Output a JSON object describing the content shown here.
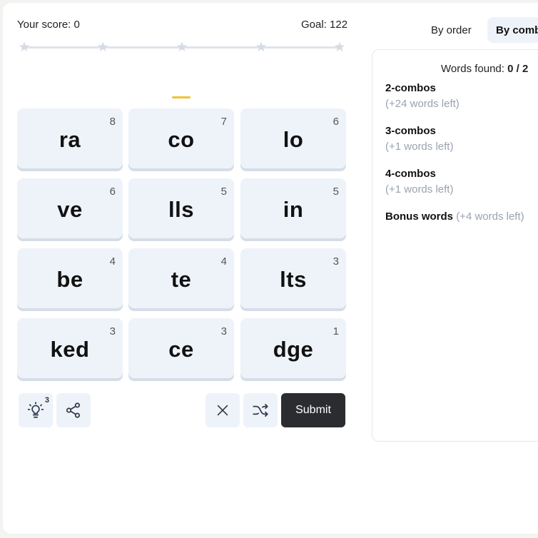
{
  "header": {
    "score_label": "Your score: 0",
    "goal_label": "Goal: 122",
    "progress_fraction": 0
  },
  "tiles": [
    {
      "text": "ra",
      "count": "8"
    },
    {
      "text": "co",
      "count": "7"
    },
    {
      "text": "lo",
      "count": "6"
    },
    {
      "text": "ve",
      "count": "6"
    },
    {
      "text": "lls",
      "count": "5"
    },
    {
      "text": "in",
      "count": "5"
    },
    {
      "text": "be",
      "count": "4"
    },
    {
      "text": "te",
      "count": "4"
    },
    {
      "text": "lts",
      "count": "3"
    },
    {
      "text": "ked",
      "count": "3"
    },
    {
      "text": "ce",
      "count": "3"
    },
    {
      "text": "dge",
      "count": "1"
    }
  ],
  "controls": {
    "hint_count": "3",
    "submit_label": "Submit"
  },
  "tabs": {
    "by_order": "By order",
    "by_combo": "By comb"
  },
  "panel": {
    "found_label": "Words found: ",
    "found_value": "0 / 2",
    "groups": [
      {
        "title": "2-combos",
        "subtitle": "(+24 words left)"
      },
      {
        "title": "3-combos",
        "subtitle": "(+1 words left)"
      },
      {
        "title": "4-combos",
        "subtitle": "(+1 words left)"
      }
    ],
    "bonus_title": "Bonus words",
    "bonus_subtitle": "(+4 words left)"
  },
  "colors": {
    "accent_cursor": "#f2c230",
    "tile_bg": "#eef3fa",
    "submit_bg": "#2b2c2f"
  }
}
